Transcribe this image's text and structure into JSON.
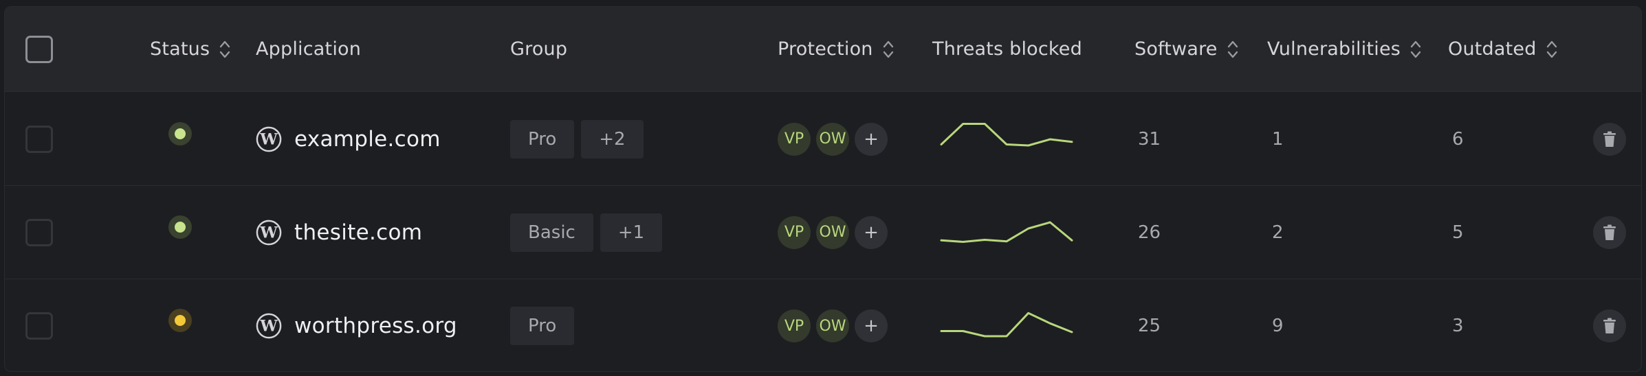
{
  "header": {
    "status": "Status",
    "application": "Application",
    "group": "Group",
    "protection": "Protection",
    "threats_blocked": "Threats blocked",
    "software": "Software",
    "vulnerabilities": "Vulnerabilities",
    "outdated": "Outdated"
  },
  "colors": {
    "accent_green": "#b8d77c",
    "status_ok": "#c8e48e",
    "status_warn": "#f3c93a"
  },
  "rows": [
    {
      "status": "ok",
      "icon": "wordpress-icon",
      "name": "example.com",
      "group": "Pro",
      "group_more": "+2",
      "protection": [
        "VP",
        "OW"
      ],
      "protection_more": "+",
      "threats": [
        3,
        7,
        7,
        3,
        2.8,
        4,
        3.5
      ],
      "software": "31",
      "vulnerabilities": "1",
      "outdated": "6"
    },
    {
      "status": "ok",
      "icon": "wordpress-icon",
      "name": "thesite.com",
      "group": "Basic",
      "group_more": "+1",
      "protection": [
        "VP",
        "OW"
      ],
      "protection_more": "+",
      "threats": [
        2.5,
        2.2,
        2.6,
        2.3,
        4.8,
        6,
        2.5
      ],
      "software": "26",
      "vulnerabilities": "2",
      "outdated": "5"
    },
    {
      "status": "warn",
      "icon": "wordpress-icon",
      "name": "worthpress.org",
      "group": "Pro",
      "group_more": "",
      "protection": [
        "VP",
        "OW"
      ],
      "protection_more": "+",
      "threats": [
        3,
        3,
        2,
        2,
        6.5,
        4.5,
        2.8
      ],
      "software": "25",
      "vulnerabilities": "9",
      "outdated": "3"
    }
  ]
}
